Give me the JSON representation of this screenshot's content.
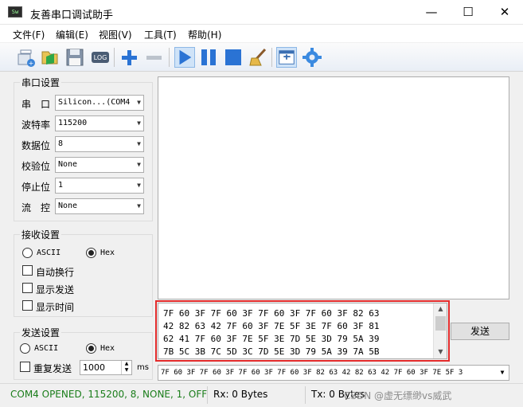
{
  "window": {
    "title": "友善串口调试助手",
    "icon_label": "Sw",
    "minimize_icon": "minimize-icon",
    "maximize_icon": "maximize-icon",
    "close_icon": "close-icon"
  },
  "menu": [
    "文件(F)",
    "编辑(E)",
    "视图(V)",
    "工具(T)",
    "帮助(H)"
  ],
  "toolbar": {
    "log_label": "LOG",
    "icons": [
      "new-session-icon",
      "open-icon",
      "save-icon",
      "log-icon",
      "add-icon",
      "remove-icon",
      "play-icon",
      "pause-icon",
      "stop-icon",
      "clear-icon",
      "window-icon",
      "settings-icon"
    ]
  },
  "serial": {
    "title": "串口设置",
    "fields": [
      {
        "label": "串　口",
        "value": "Silicon...(COM4"
      },
      {
        "label": "波特率",
        "value": "115200"
      },
      {
        "label": "数据位",
        "value": "8"
      },
      {
        "label": "校验位",
        "value": "None"
      },
      {
        "label": "停止位",
        "value": "1"
      },
      {
        "label": "流　控",
        "value": "None"
      }
    ]
  },
  "receive": {
    "title": "接收设置",
    "ascii": "ASCII",
    "hex": "Hex",
    "selected": "Hex",
    "options": [
      "自动换行",
      "显示发送",
      "显示时间"
    ]
  },
  "send": {
    "title": "发送设置",
    "ascii": "ASCII",
    "hex": "Hex",
    "selected": "Hex",
    "repeat_label": "重复发送",
    "interval": "1000",
    "unit": "ms",
    "button": "发送",
    "lines": [
      "7F 60 3F 7F 60 3F 7F 60 3F 7F 60 3F 82 63",
      "42 82 63 42 7F 60 3F 7E 5F 3E 7F 60 3F 81",
      "62 41 7F 60 3F 7E 5F 3E 7D 5E 3D 79 5A 39",
      "7B 5C 3B 7C 5D 3C 7D 5E 3D 79 5A 39 7A 5B"
    ],
    "history": "7F 60 3F 7F 60 3F 7F 60 3F 7F 60 3F 82 63 42 82 63 42 7F 60 3F 7E 5F 3"
  },
  "status": {
    "port": "COM4 OPENED, 115200, 8, NONE, 1, OFF",
    "rx": "Rx: 0 Bytes",
    "tx": "Tx: 0 Bytes",
    "watermark": "CSDN @虚无缥缈vs威武"
  },
  "colors": {
    "status_text": "#1a7d1a",
    "highlight_border": "#e32b2b",
    "toolbar_blue": "#2a73d4"
  }
}
